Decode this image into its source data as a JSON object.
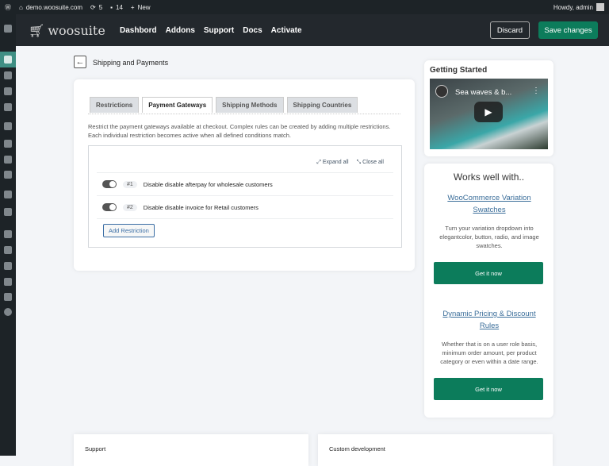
{
  "adminbar": {
    "site": "demo.woosuite.com",
    "updates": "5",
    "comments": "14",
    "new": "New",
    "howdy": "Howdy, admin"
  },
  "header": {
    "logo": "woosuite",
    "nav": [
      "Dashbord",
      "Addons",
      "Support",
      "Docs",
      "Activate"
    ],
    "discard": "Discard",
    "save": "Save changes"
  },
  "page": {
    "title": "Shipping and Payments"
  },
  "tabs": [
    "Restrictions",
    "Payment Gateways",
    "Shipping Methods",
    "Shipping Countries"
  ],
  "description": [
    "Restrict the payment gateways available at checkout. Complex rules can be created by adding multiple restrictions.",
    "Each individual restriction becomes active when all defined conditions match."
  ],
  "tools": {
    "expand": "Expand all",
    "close": "Close all"
  },
  "restrictions": [
    {
      "num": "#1",
      "label": "Disable disable afterpay for wholesale customers",
      "enabled": true
    },
    {
      "num": "#2",
      "label": "Disable disable invoice for Retail customers",
      "enabled": true
    }
  ],
  "add_restriction": "Add Restriction",
  "getting_started": {
    "title": "Getting Started",
    "video_title": "Sea waves & b..."
  },
  "works": {
    "title": "Works well with..",
    "products": [
      {
        "name": "WooCommerce Variation Swatches",
        "desc": "Turn your variation dropdown into elegantcolor, button, radio, and image swatches.",
        "button": "Get it now"
      },
      {
        "name": "Dynamic Pricing & Discount Rules",
        "desc": "Whether that is on a user role basis, minimum order amount, per product category or even within a date range.",
        "button": "Get it now"
      }
    ]
  },
  "bottom": {
    "support": "Support",
    "custom": "Custom development"
  }
}
